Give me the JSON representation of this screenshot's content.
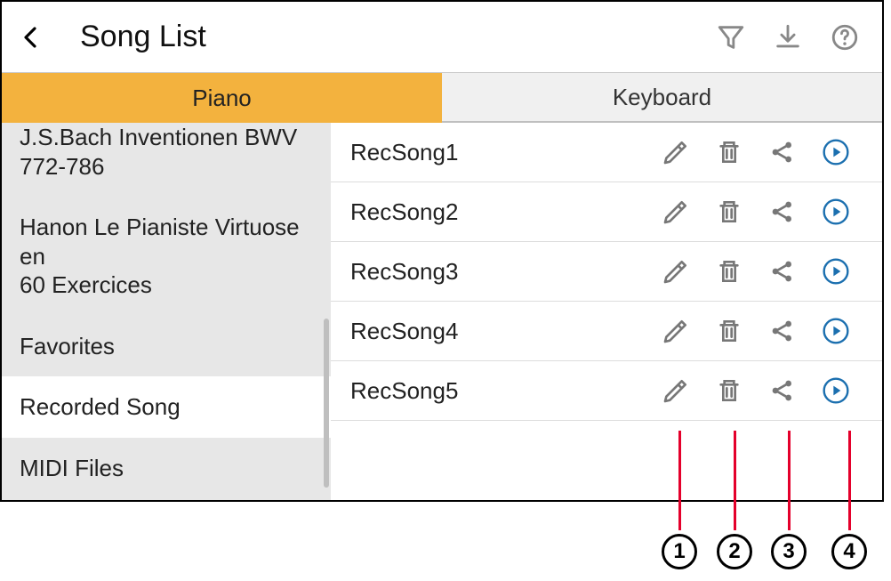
{
  "header": {
    "title": "Song List"
  },
  "tabs": {
    "piano": "Piano",
    "keyboard": "Keyboard"
  },
  "sidebar": {
    "items": [
      "J.S.Bach Inventionen BWV 772-786",
      "Hanon Le Pianiste Virtuose en\n60 Exercices",
      "Favorites",
      "Recorded Song",
      "MIDI Files"
    ]
  },
  "songs": [
    "RecSong1",
    "RecSong2",
    "RecSong3",
    "RecSong4",
    "RecSong5"
  ],
  "callouts": [
    "1",
    "2",
    "3",
    "4"
  ]
}
